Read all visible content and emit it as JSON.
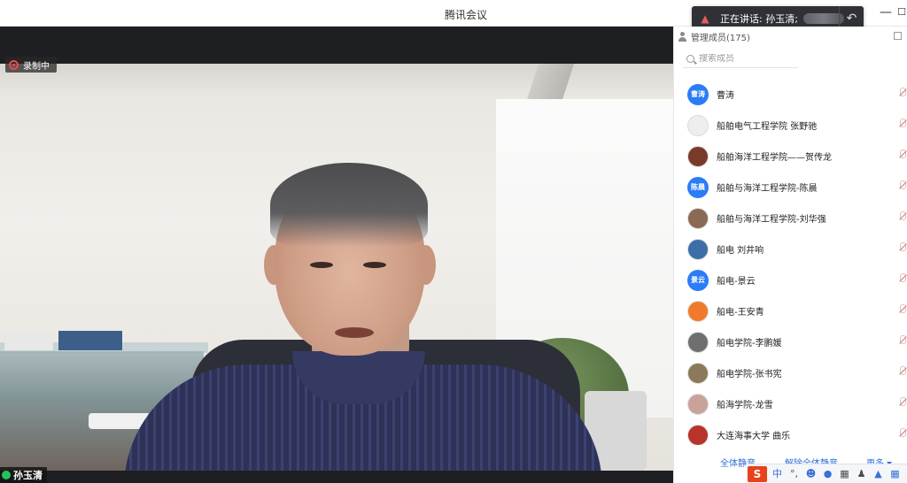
{
  "window": {
    "title": "腾讯会议",
    "minimize_glyph": "—",
    "maximize_glyph": "☐"
  },
  "video": {
    "recording_label": "录制中",
    "speaker_name": "孙玉清"
  },
  "speaking_popup": {
    "label": "正在讲话: 孙玉清;",
    "action_icon": "reply-icon"
  },
  "panel": {
    "title": "管理成员(175)",
    "search_placeholder": "搜索成员",
    "members": [
      {
        "name": "曹涛",
        "avatar_text": "曹涛",
        "avatar_color": "#2b7cf6"
      },
      {
        "name": "船舶电气工程学院 张野驰",
        "avatar_text": "",
        "avatar_color": "#eeeeee"
      },
      {
        "name": "船舶海洋工程学院——贺传龙",
        "avatar_text": "",
        "avatar_color": "#7a3a2a"
      },
      {
        "name": "船舶与海洋工程学院-陈晨",
        "avatar_text": "陈晨",
        "avatar_color": "#2b7cf6"
      },
      {
        "name": "船舶与海洋工程学院-刘华强",
        "avatar_text": "",
        "avatar_color": "#8a6a52"
      },
      {
        "name": "船电 刘井响",
        "avatar_text": "",
        "avatar_color": "#3d6ea8"
      },
      {
        "name": "船电-景云",
        "avatar_text": "景云",
        "avatar_color": "#2b7cf6"
      },
      {
        "name": "船电-王安青",
        "avatar_text": "",
        "avatar_color": "#f07a2a"
      },
      {
        "name": "船电学院-李鹏媛",
        "avatar_text": "",
        "avatar_color": "#6f6f6f"
      },
      {
        "name": "船电学院-张书宪",
        "avatar_text": "",
        "avatar_color": "#8a7a5a"
      },
      {
        "name": "船海学院-龙雪",
        "avatar_text": "",
        "avatar_color": "#c9a39a"
      },
      {
        "name": "大连海事大学 曲乐",
        "avatar_text": "",
        "avatar_color": "#b8342a"
      }
    ],
    "footer": {
      "mute_all": "全体静音",
      "unmute_all": "解除全体静音",
      "more": "更多"
    }
  },
  "ime": {
    "logo": "S",
    "lang": "中",
    "punct": "°,"
  }
}
